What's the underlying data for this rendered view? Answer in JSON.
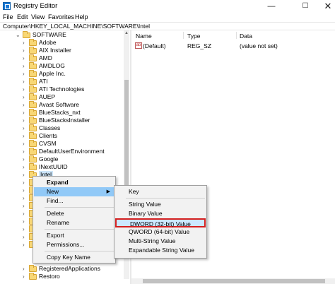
{
  "window": {
    "title": "Registry Editor",
    "controls": {
      "minimize": "—",
      "maximize": "☐",
      "close": "✕"
    }
  },
  "menu": [
    "File",
    "Edit",
    "View",
    "Favorites",
    "Help"
  ],
  "address": "Computer\\HKEY_LOCAL_MACHINE\\SOFTWARE\\Intel",
  "tree": {
    "parent": "SOFTWARE",
    "children": [
      "Adobe",
      "AIX Installer",
      "AMD",
      "AMDLOG",
      "Apple Inc.",
      "ATI",
      "ATI Technologies",
      "AUEP",
      "Avast Software",
      "BlueStacks_nxt",
      "BlueStacksInstaller",
      "Classes",
      "Clients",
      "CVSM",
      "DefaultUserEnvironment",
      "Google",
      "INextUUID",
      "Intel"
    ],
    "bottom_children": [
      "RegisteredApplications",
      "Restoro"
    ]
  },
  "list": {
    "columns": [
      "Name",
      "Type",
      "Data"
    ],
    "rows": [
      {
        "name": "(Default)",
        "type": "REG_SZ",
        "data": "(value not set)"
      }
    ]
  },
  "context_menu": {
    "items": [
      "Expand",
      "New",
      "Find...",
      "Delete",
      "Rename",
      "Export",
      "Permissions...",
      "Copy Key Name"
    ]
  },
  "new_submenu": {
    "items": [
      "Key",
      "String Value",
      "Binary Value",
      "DWORD (32-bit) Value",
      "QWORD (64-bit) Value",
      "Multi-String Value",
      "Expandable String Value"
    ],
    "highlighted": "DWORD (32-bit) Value",
    "highlight_color": "#d42020"
  }
}
